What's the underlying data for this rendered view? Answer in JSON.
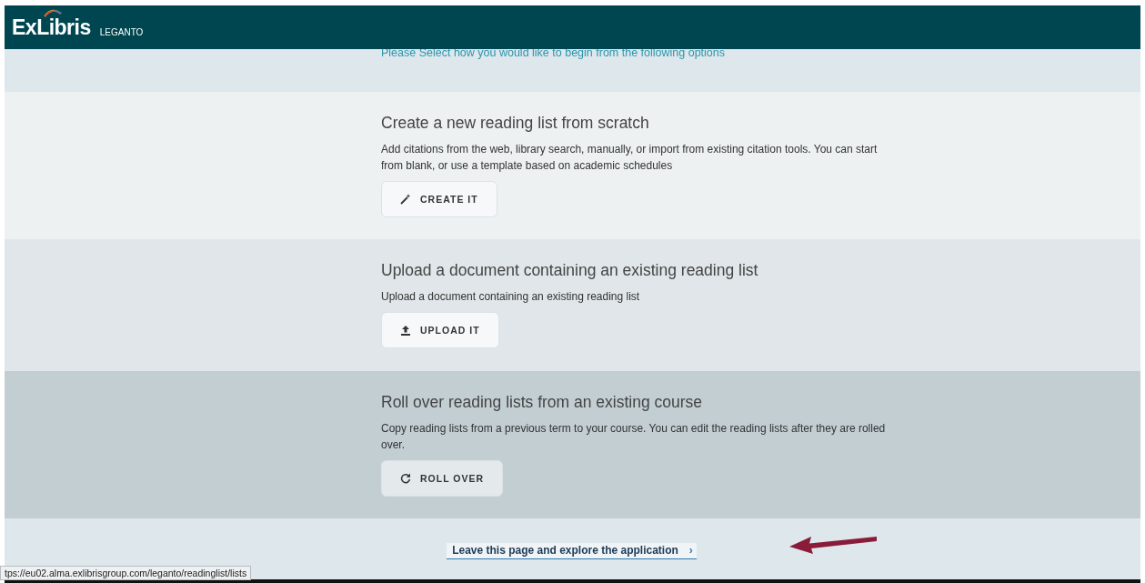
{
  "header": {
    "brand": "ExLibris",
    "product": "LEGANTO"
  },
  "intro": {
    "text": "Please Select how you would like to begin from the following options"
  },
  "options": [
    {
      "kind": "create",
      "title": "Create a new reading list from scratch",
      "description": "Add citations from the web, library search, manually, or import from existing citation tools. You can start from blank, or use a template based on academic schedules",
      "button": "CREATE IT",
      "highlighted": false
    },
    {
      "kind": "upload",
      "title": "Upload a document containing an existing reading list",
      "description": "Upload a document containing an existing reading list",
      "button": "UPLOAD IT",
      "highlighted": false
    },
    {
      "kind": "rollover",
      "title": "Roll over reading lists from an existing course",
      "description": "Copy reading lists from a previous term to your course. You can edit the reading lists after they are rolled over.",
      "button": "ROLL OVER",
      "highlighted": true
    }
  ],
  "footer": {
    "link": "Leave this page and explore the application",
    "chevron": "›"
  },
  "status_url": "tps://eu02.alma.exlibrisgroup.com/leganto/readinglist/lists"
}
